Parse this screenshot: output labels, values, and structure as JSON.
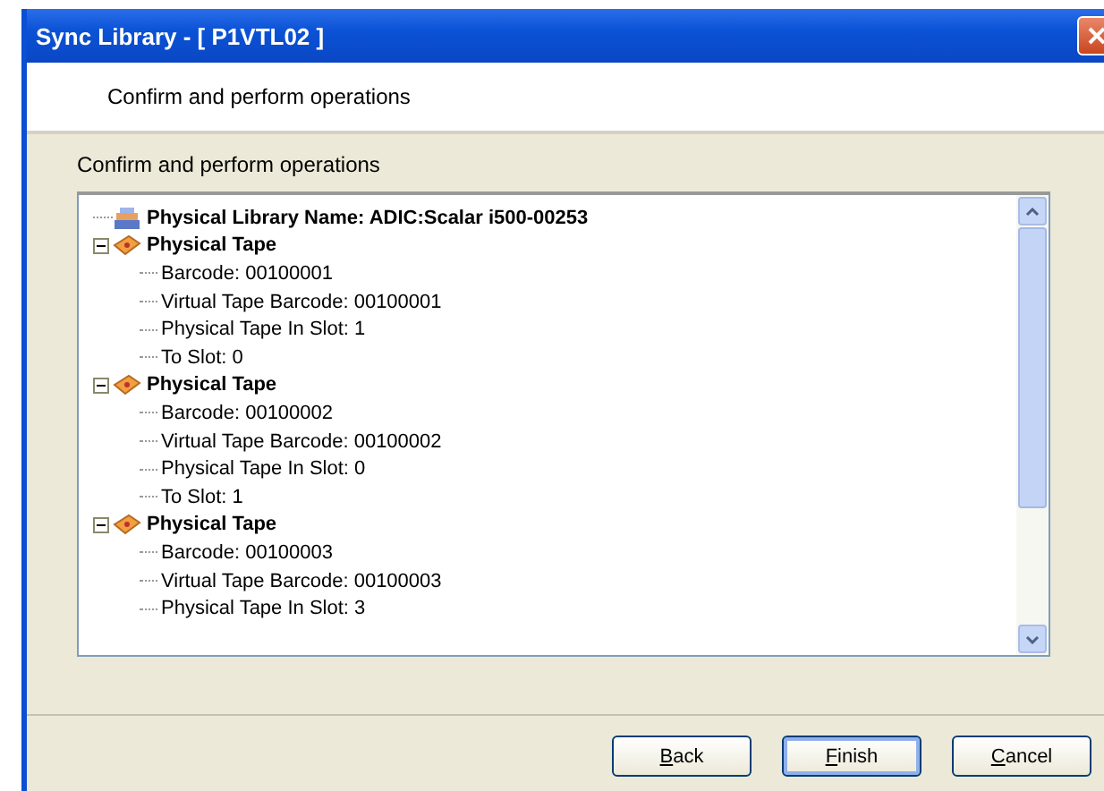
{
  "window": {
    "title": "Sync Library - [ P1VTL02 ]"
  },
  "header": {
    "text": "Confirm and perform operations"
  },
  "section_label": "Confirm and perform operations",
  "tree": [
    {
      "kind": "library",
      "label": "Physical Library Name: ADIC:Scalar i500-00253"
    },
    {
      "kind": "tape",
      "label": "Physical Tape",
      "expanded": true,
      "children": [
        {
          "label": "Barcode: 00100001"
        },
        {
          "label": "Virtual Tape Barcode: 00100001"
        },
        {
          "label": "Physical Tape In Slot: 1"
        },
        {
          "label": "To Slot: 0"
        }
      ]
    },
    {
      "kind": "tape",
      "label": "Physical Tape",
      "expanded": true,
      "children": [
        {
          "label": "Barcode: 00100002"
        },
        {
          "label": "Virtual Tape Barcode: 00100002"
        },
        {
          "label": "Physical Tape In Slot: 0"
        },
        {
          "label": "To Slot: 1"
        }
      ]
    },
    {
      "kind": "tape",
      "label": "Physical Tape",
      "expanded": true,
      "children": [
        {
          "label": "Barcode: 00100003"
        },
        {
          "label": "Virtual Tape Barcode: 00100003"
        },
        {
          "label": "Physical Tape In Slot: 3"
        }
      ]
    }
  ],
  "buttons": [
    {
      "label": "Back",
      "default": false
    },
    {
      "label": "Finish",
      "default": true
    },
    {
      "label": "Cancel",
      "default": false
    }
  ]
}
